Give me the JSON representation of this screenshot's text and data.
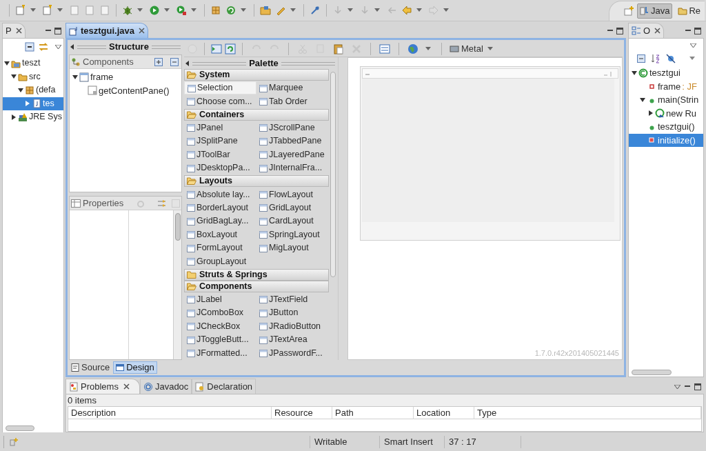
{
  "perspectives": [
    {
      "label": "Java",
      "selected": true
    },
    {
      "label": "Re",
      "selected": false
    }
  ],
  "package_explorer": {
    "tab": "P",
    "tree": [
      {
        "label": "teszt",
        "kind": "project",
        "expanded": true,
        "selected": false,
        "children": [
          {
            "label": "src",
            "kind": "folder",
            "expanded": true,
            "selected": false,
            "children": [
              {
                "label": "(defa",
                "kind": "package",
                "expanded": true,
                "selected": false,
                "children": [
                  {
                    "label": "tes",
                    "kind": "file",
                    "expanded": false,
                    "selected": true
                  }
                ]
              }
            ]
          },
          {
            "label": "JRE Sys",
            "kind": "library",
            "expanded": false,
            "selected": false
          }
        ]
      }
    ]
  },
  "editor": {
    "tab": "tesztgui.java",
    "structure": {
      "title": "Structure",
      "components_label": "Components",
      "tree": [
        {
          "label": "frame",
          "kind": "frame",
          "expanded": true,
          "selected": false,
          "children": [
            {
              "label": "getContentPane()",
              "kind": "pane",
              "selected": false
            }
          ]
        }
      ],
      "properties_label": "Properties"
    },
    "look_and_feel": "Metal",
    "palette": {
      "title": "Palette",
      "groups": [
        {
          "name": "System",
          "expanded": true,
          "items": [
            {
              "label": "Selection",
              "selected": true
            },
            {
              "label": "Marquee",
              "selected": false
            },
            {
              "label": "Choose com...",
              "selected": false
            },
            {
              "label": "Tab Order",
              "selected": false
            }
          ]
        },
        {
          "name": "Containers",
          "expanded": true,
          "items": [
            {
              "label": "JPanel",
              "selected": false
            },
            {
              "label": "JScrollPane",
              "selected": false
            },
            {
              "label": "JSplitPane",
              "selected": false
            },
            {
              "label": "JTabbedPane",
              "selected": false
            },
            {
              "label": "JToolBar",
              "selected": false
            },
            {
              "label": "JLayeredPane",
              "selected": false
            },
            {
              "label": "JDesktopPa...",
              "selected": false
            },
            {
              "label": "JInternalFra...",
              "selected": false
            }
          ]
        },
        {
          "name": "Layouts",
          "expanded": true,
          "items": [
            {
              "label": "Absolute lay...",
              "selected": false
            },
            {
              "label": "FlowLayout",
              "selected": false
            },
            {
              "label": "BorderLayout",
              "selected": false
            },
            {
              "label": "GridLayout",
              "selected": false
            },
            {
              "label": "GridBagLay...",
              "selected": false
            },
            {
              "label": "CardLayout",
              "selected": false
            },
            {
              "label": "BoxLayout",
              "selected": false
            },
            {
              "label": "SpringLayout",
              "selected": false
            },
            {
              "label": "FormLayout",
              "selected": false
            },
            {
              "label": "MigLayout",
              "selected": false
            },
            {
              "label": "GroupLayout",
              "selected": false
            }
          ]
        },
        {
          "name": "Struts & Springs",
          "expanded": false
        },
        {
          "name": "Components",
          "expanded": true,
          "items": [
            {
              "label": "JLabel",
              "selected": false
            },
            {
              "label": "JTextField",
              "selected": false
            },
            {
              "label": "JComboBox",
              "selected": false
            },
            {
              "label": "JButton",
              "selected": false
            },
            {
              "label": "JCheckBox",
              "selected": false
            },
            {
              "label": "JRadioButton",
              "selected": false
            },
            {
              "label": "JToggleButt...",
              "selected": false
            },
            {
              "label": "JTextArea",
              "selected": false
            },
            {
              "label": "JFormatted...",
              "selected": false
            },
            {
              "label": "JPasswordF...",
              "selected": false
            }
          ]
        }
      ]
    },
    "version": "1.7.0.r42x201405021445",
    "bottom_tabs": [
      {
        "label": "Source",
        "selected": false
      },
      {
        "label": "Design",
        "selected": true
      }
    ]
  },
  "outline": {
    "tab": "O",
    "tree": [
      {
        "label": "tesztgui",
        "kind": "class",
        "expanded": true,
        "selected": false,
        "children": [
          {
            "label": "frame",
            "type": ": JF",
            "kind": "field",
            "selected": false
          },
          {
            "label": "main(Strin",
            "kind": "static-method",
            "expanded": true,
            "selected": false,
            "children": [
              {
                "label": "new Ru",
                "kind": "anonymous",
                "expanded": false,
                "selected": false
              }
            ]
          },
          {
            "label": "tesztgui()",
            "kind": "constructor",
            "selected": false
          },
          {
            "label": "initialize()",
            "kind": "private-method",
            "selected": true
          }
        ]
      }
    ]
  },
  "bottom_panel": {
    "tabs": [
      {
        "label": "Problems",
        "selected": true
      },
      {
        "label": "Javadoc",
        "selected": false
      },
      {
        "label": "Declaration",
        "selected": false
      }
    ],
    "summary": "0 items",
    "columns": [
      "Description",
      "Resource",
      "Path",
      "Location",
      "Type"
    ]
  },
  "status_bar": [
    "Writable",
    "Smart Insert",
    "37 : 17"
  ]
}
